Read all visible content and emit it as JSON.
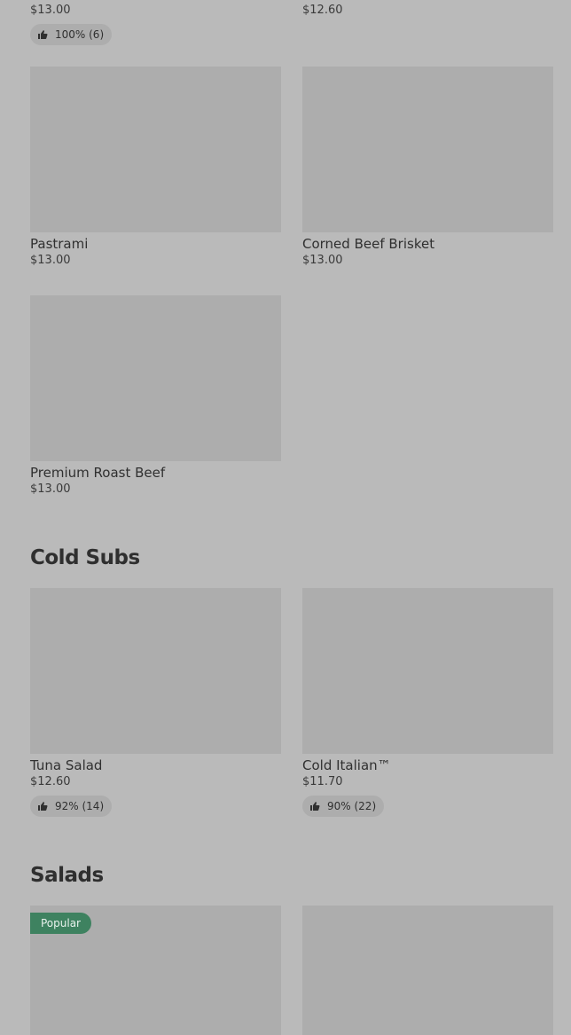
{
  "top_row": {
    "left": {
      "price": "$13.00",
      "rating": "100% (6)"
    },
    "right": {
      "price": "$12.60"
    }
  },
  "items": {
    "pastrami": {
      "name": "Pastrami",
      "price": "$13.00"
    },
    "corned_beef": {
      "name": "Corned Beef Brisket",
      "price": "$13.00"
    },
    "roast_beef": {
      "name": "Premium Roast Beef",
      "price": "$13.00"
    },
    "tuna_salad": {
      "name": "Tuna Salad",
      "price": "$12.60",
      "rating": "92% (14)"
    },
    "cold_italian": {
      "name": "Cold Italian™",
      "price": "$11.70",
      "rating": "90% (22)"
    }
  },
  "sections": {
    "cold_subs": "Cold Subs",
    "salads": "Salads"
  },
  "salads_row": {
    "left_badge": "Popular"
  },
  "colors": {
    "background": "#bababa",
    "placeholder": "#adadad",
    "popular_badge": "#3e8260"
  },
  "icons": {
    "rating": "thumbs-up-icon"
  }
}
